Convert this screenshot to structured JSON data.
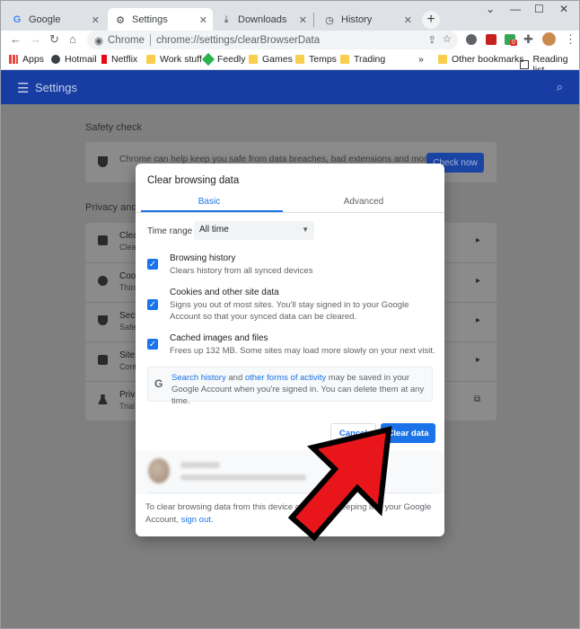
{
  "browser": {
    "tabs": [
      {
        "label": "Google",
        "icon": "google-g-icon"
      },
      {
        "label": "Settings",
        "icon": "gear-icon"
      },
      {
        "label": "Downloads",
        "icon": "download-icon"
      },
      {
        "label": "History",
        "icon": "history-icon"
      }
    ],
    "omnibox": {
      "chip": "Chrome",
      "url": "chrome://settings/clearBrowserData"
    },
    "bookmarks": [
      {
        "label": "Apps"
      },
      {
        "label": "Hotmail"
      },
      {
        "label": "Netflix"
      },
      {
        "label": "Work stuff"
      },
      {
        "label": "Feedly"
      },
      {
        "label": "Games"
      },
      {
        "label": "Temps"
      },
      {
        "label": "Trading"
      }
    ],
    "overflow": "»",
    "other_bookmarks": "Other bookmarks",
    "reading_list": "Reading list",
    "ext_badge": "0"
  },
  "settings": {
    "header_title": "Settings",
    "safety_check_title": "Safety check",
    "safety_check_text": "Chrome can help keep you safe from data breaches, bad extensions and more",
    "check_now": "Check now",
    "privacy_title": "Privacy and s",
    "privacy_rows": [
      {
        "title": "Clear",
        "sub": "Clea"
      },
      {
        "title": "Cook",
        "sub": "Third"
      },
      {
        "title": "Secu",
        "sub": "Safe"
      },
      {
        "title": "Site s",
        "sub": "Contr"
      },
      {
        "title": "Priva",
        "sub": "Trial"
      }
    ]
  },
  "dialog": {
    "title": "Clear browsing data",
    "tab_basic": "Basic",
    "tab_advanced": "Advanced",
    "time_range_label": "Time range",
    "time_range_value": "All time",
    "options": [
      {
        "title": "Browsing history",
        "desc": "Clears history from all synced devices",
        "checked": true
      },
      {
        "title": "Cookies and other site data",
        "desc": "Signs you out of most sites. You'll stay signed in to your Google Account so that your synced data can be cleared.",
        "checked": true
      },
      {
        "title": "Cached images and files",
        "desc": "Frees up 132 MB. Some sites may load more slowly on your next visit.",
        "checked": true
      }
    ],
    "notice": {
      "link1": "Search history",
      "and": " and ",
      "link2": "other forms of activity",
      "rest": " may be saved in your Google Account when you're signed in. You can delete them at any time."
    },
    "cancel": "Cancel",
    "clear_data": "Clear data",
    "footer_text": "To clear browsing data from this device only, while keeping it in your Google Account, ",
    "footer_link": "sign out",
    "footer_end": "."
  },
  "colors": {
    "accent": "#1a73e8",
    "header_blue": "#173da3",
    "arrow_red": "#e8151b"
  }
}
